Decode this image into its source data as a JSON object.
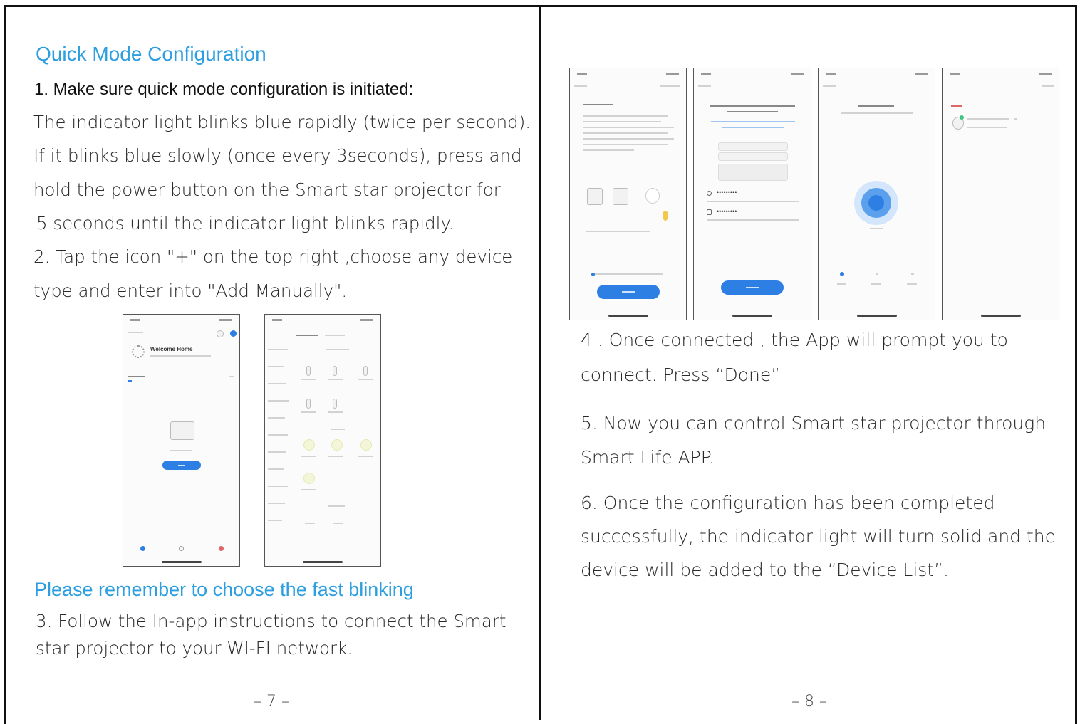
{
  "left_page": {
    "heading": "Quick Mode Configuration",
    "step1_title": "1. Make sure quick mode configuration is initiated:",
    "step1_lines": [
      "The indicator light blinks blue rapidly (twice per second).",
      "If it blinks blue slowly (once every 3seconds), press and",
      "hold the power button on the Smart star projector for",
      "5 seconds until the indicator light blinks rapidly."
    ],
    "step2_lines": [
      "2. Tap the icon \"+\" on the top right  ,choose any device",
      "type and enter into \"Add Manually\"."
    ],
    "phone1_title": "Welcome Home",
    "reminder": "Please remember to choose the fast blinking",
    "step3_lines": [
      "3.  Follow the In-app instructions to connect the Smart",
      "star projector to your WI-FI network."
    ],
    "page_number": "– 7 –"
  },
  "right_page": {
    "password_mask_1": "•••••••••",
    "password_mask_2": "•••••••••",
    "step4_lines": [
      "4 . Once connected , the App will prompt you to",
      "connect. Press “Done”"
    ],
    "step5_lines": [
      "5. Now you can control Smart star projector through",
      "Smart Life APP."
    ],
    "step6_lines": [
      "6. Once the configuration has been completed",
      "successfully, the indicator light will turn solid and the",
      "device will be added to the “Device List”."
    ],
    "page_number": "– 8 –"
  },
  "colors": {
    "accent_blue": "#2d9fe0",
    "button_blue": "#2e7fe3",
    "border": "#111111"
  },
  "icons": [
    "sun-icon",
    "add-icon",
    "home-tab-icon",
    "scene-tab-icon",
    "profile-tab-icon",
    "router-icon",
    "search-radar-icon",
    "wifi-icon",
    "lock-icon"
  ]
}
